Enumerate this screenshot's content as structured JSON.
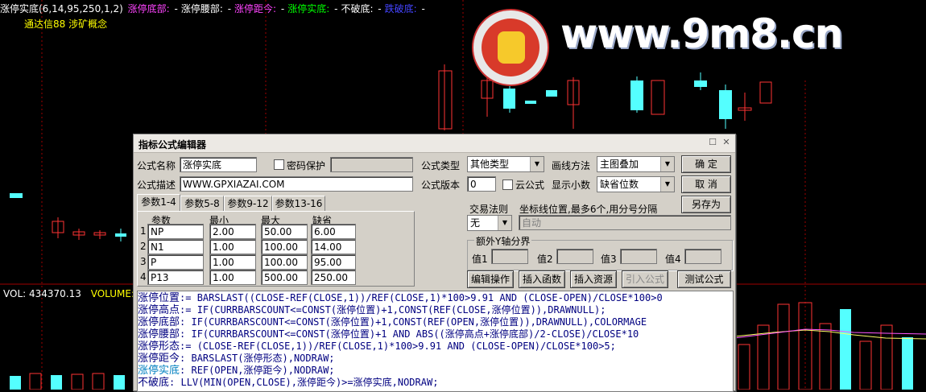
{
  "header": {
    "indicator": "涨停实底(6,14,95,250,1,2)",
    "items": [
      {
        "label": "涨停底部:",
        "value": " -",
        "color": "#ff44ff"
      },
      {
        "label": "涨停腰部:",
        "value": " -",
        "color": "#ffffff"
      },
      {
        "label": "涨停距今:",
        "value": " -",
        "color": "#ff44ff"
      },
      {
        "label": "涨停实底:",
        "value": " -",
        "color": "#00ff00"
      },
      {
        "label": "不破底:",
        "value": " -",
        "color": "#ffffff"
      },
      {
        "label": "跌破底:",
        "value": " -",
        "color": "#4444ff"
      }
    ],
    "sub": "通达信88 涉矿概念"
  },
  "volume_header": {
    "label": "VOL: 434370.13",
    "label2": "VOLUME:"
  },
  "watermark": {
    "text": "www.9m8.cn"
  },
  "colors": {
    "up": "#ff3333",
    "down": "#54ffff",
    "bg": "#000000",
    "dialog": "#d4d0c8"
  },
  "dialog": {
    "title": "指标公式编辑器",
    "name_label": "公式名称",
    "name_value": "涨停实底",
    "password_label": "密码保护",
    "password_value": "",
    "type_label": "公式类型",
    "type_value": "其他类型",
    "draw_label": "画线方法",
    "draw_value": "主图叠加",
    "ok_button": "确 定",
    "cancel_button": "取 消",
    "desc_label": "公式描述",
    "desc_value": "WWW.GPXIAZAI.COM",
    "version_label": "公式版本",
    "version_value": "0",
    "cloud_label": "云公式",
    "decimals_label": "显示小数",
    "decimals_value": "缺省位数",
    "saveas_button": "另存为",
    "tabs": [
      "参数1-4",
      "参数5-8",
      "参数9-12",
      "参数13-16"
    ],
    "param_headers": [
      "参数",
      "最小",
      "最大",
      "缺省"
    ],
    "params": [
      {
        "idx": "1",
        "name": "NP",
        "min": "2.00",
        "max": "50.00",
        "def": "6.00"
      },
      {
        "idx": "2",
        "name": "N1",
        "min": "1.00",
        "max": "100.00",
        "def": "14.00"
      },
      {
        "idx": "3",
        "name": "P",
        "min": "1.00",
        "max": "100.00",
        "def": "95.00"
      },
      {
        "idx": "4",
        "name": "P13",
        "min": "1.00",
        "max": "500.00",
        "def": "250.00"
      }
    ],
    "trade_rule_label": "交易法则",
    "trade_rule_value": "无",
    "coord_label": "坐标线位置,最多6个,用分号分隔",
    "coord_value": "自动",
    "yaxis_group": "额外Y轴分界",
    "yaxis_values": [
      {
        "label": "值1",
        "value": ""
      },
      {
        "label": "值2",
        "value": ""
      },
      {
        "label": "值3",
        "value": ""
      },
      {
        "label": "值4",
        "value": ""
      }
    ],
    "buttons": [
      "编辑操作",
      "插入函数",
      "插入资源",
      "引入公式",
      "测试公式"
    ],
    "code_lines": [
      {
        "var": "涨停位置",
        "op": ":= ",
        "expr": "BARSLAST((CLOSE-REF(CLOSE,1))/REF(CLOSE,1)*100>9.91 AND (CLOSE-OPEN)/CLOSE*100>0",
        "highlight": false
      },
      {
        "var": "涨停高点",
        "op": ":= ",
        "expr": "IF(CURRBARSCOUNT<=CONST(涨停位置)+1,CONST(REF(CLOSE,涨停位置)),DRAWNULL);",
        "highlight": false
      },
      {
        "var": "涨停底部",
        "op": ": ",
        "expr": "IF(CURRBARSCOUNT<=CONST(涨停位置)+1,CONST(REF(OPEN,涨停位置)),DRAWNULL),COLORMAGE",
        "highlight": false
      },
      {
        "var": "涨停腰部",
        "op": ": ",
        "expr": "IF(CURRBARSCOUNT<=CONST(涨停位置)+1 AND ABS((涨停高点+涨停底部)/2-CLOSE)/CLOSE*10",
        "highlight": false
      },
      {
        "var": "涨停形态",
        "op": ":= ",
        "expr": "(CLOSE-REF(CLOSE,1))/REF(CLOSE,1)*100>9.91 AND (CLOSE-OPEN)/CLOSE*100>5;",
        "highlight": false
      },
      {
        "var": "涨停距今",
        "op": ": ",
        "expr": "BARSLAST(涨停形态),NODRAW;",
        "highlight": false
      },
      {
        "var": "涨停实底",
        "op": ": ",
        "expr": "REF(OPEN,涨停距今),NODRAW;",
        "highlight": true
      },
      {
        "var": "不破底",
        "op": ": ",
        "expr": "LLV(MIN(OPEN,CLOSE),涨停距今)>=涨停实底,NODRAW;",
        "highlight": false
      }
    ]
  }
}
